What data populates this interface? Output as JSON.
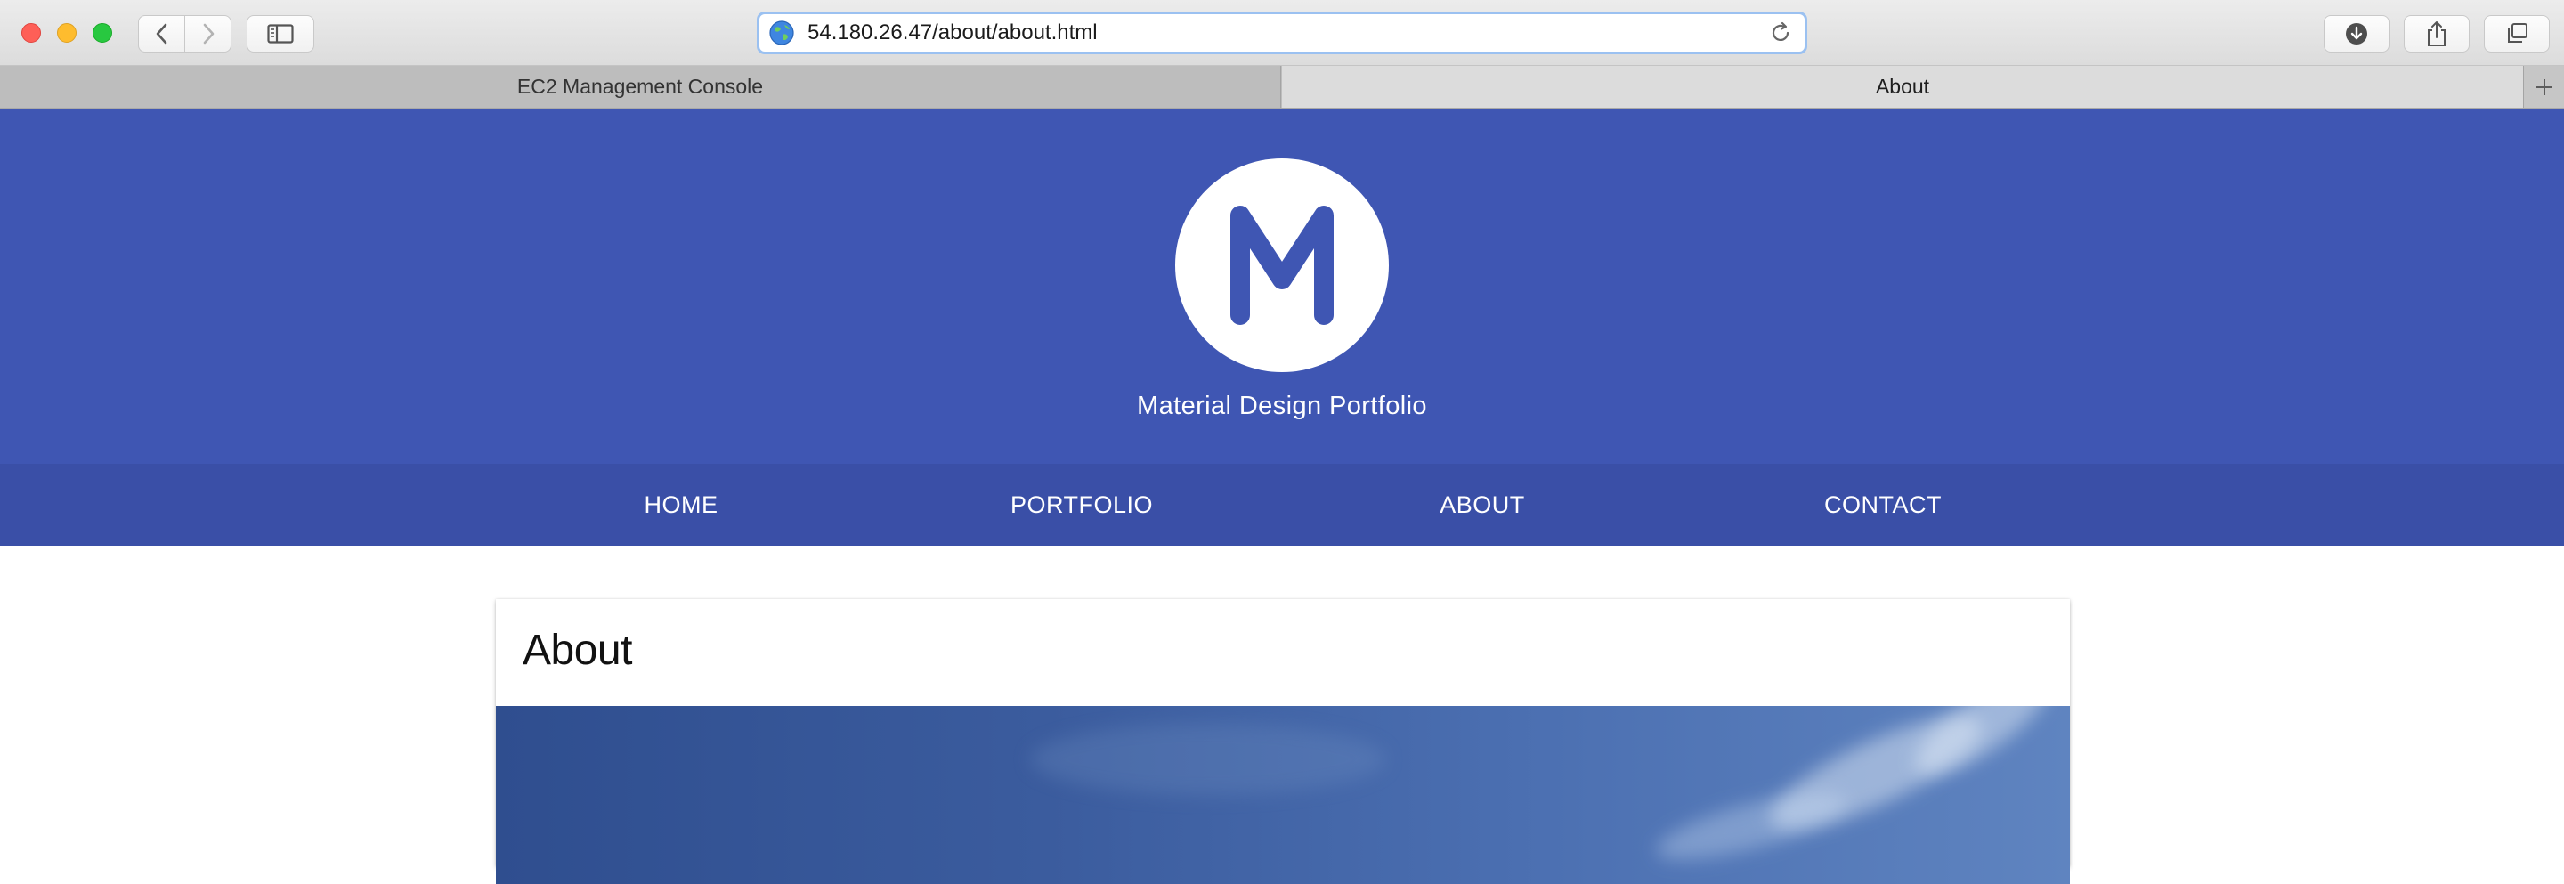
{
  "browser": {
    "url": "54.180.26.47/about/about.html",
    "tabs": [
      {
        "label": "EC2 Management Console",
        "active": false
      },
      {
        "label": "About",
        "active": true
      }
    ],
    "new_tab_icon": "plus-icon"
  },
  "header": {
    "logo_letter": "M",
    "site_title": "Material Design Portfolio",
    "background_color": "#3f56b3"
  },
  "nav": {
    "items": [
      "HOME",
      "PORTFOLIO",
      "ABOUT",
      "CONTACT"
    ],
    "background_color": "#3a4fa7"
  },
  "card": {
    "title": "About"
  },
  "colors": {
    "accent": "#3f56b3",
    "url_focus_ring": "#9bc1f1"
  }
}
